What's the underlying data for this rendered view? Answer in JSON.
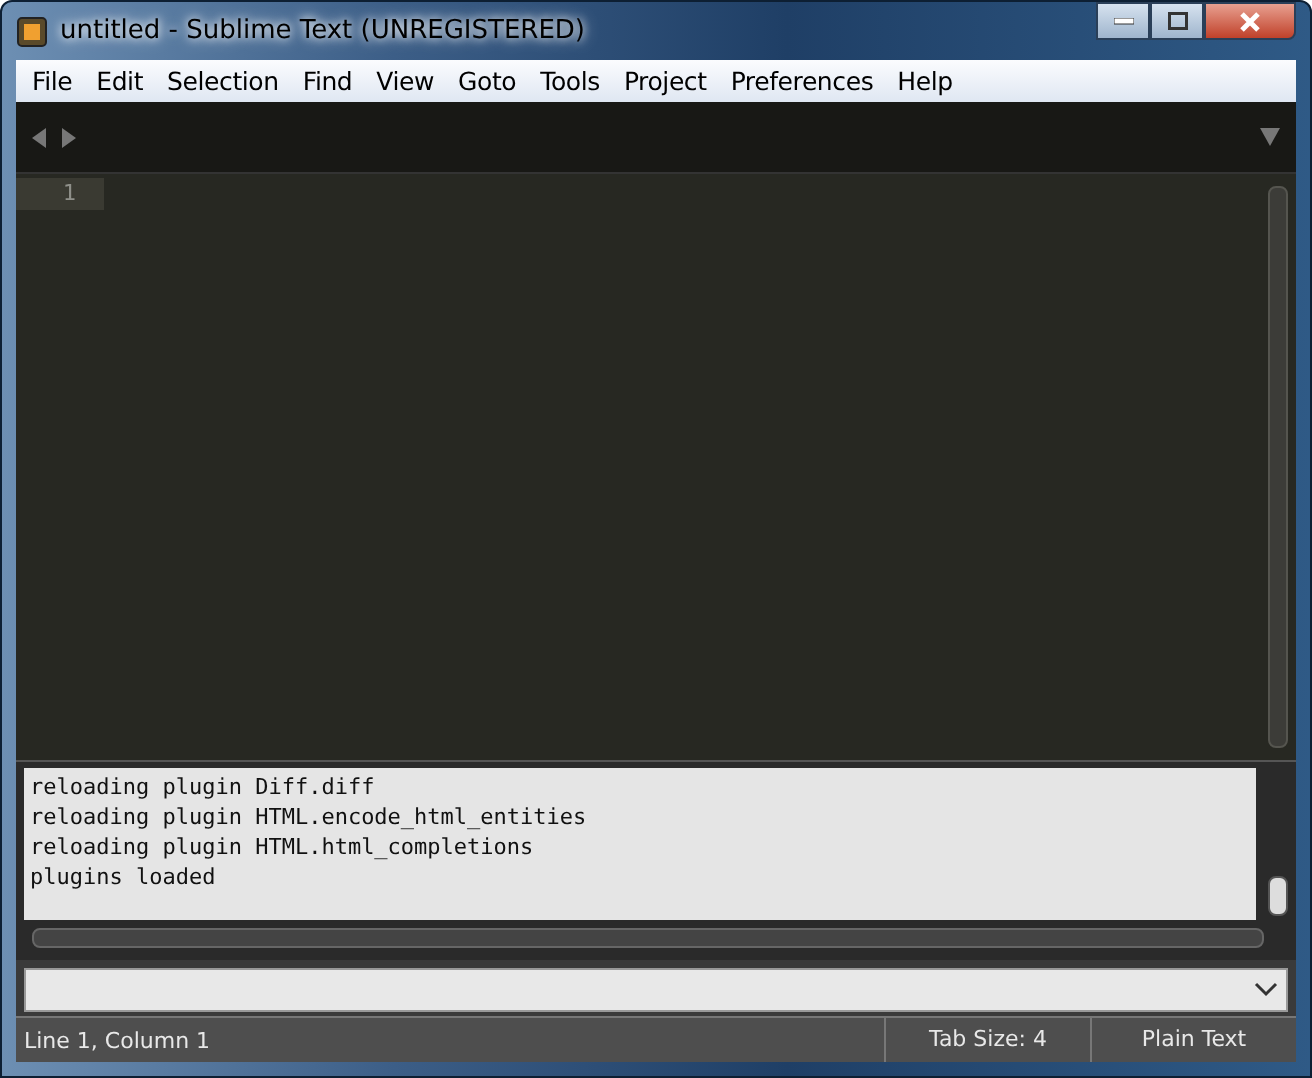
{
  "window": {
    "title": "untitled - Sublime Text (UNREGISTERED)"
  },
  "menu": [
    "File",
    "Edit",
    "Selection",
    "Find",
    "View",
    "Goto",
    "Tools",
    "Project",
    "Preferences",
    "Help"
  ],
  "editor": {
    "line_numbers": [
      "1"
    ]
  },
  "console": {
    "lines": [
      "reloading plugin Diff.diff",
      "reloading plugin HTML.encode_html_entities",
      "reloading plugin HTML.html_completions",
      "plugins loaded"
    ]
  },
  "status_bar": {
    "position": "Line 1, Column 1",
    "tab_size": "Tab Size: 4",
    "syntax": "Plain Text"
  }
}
